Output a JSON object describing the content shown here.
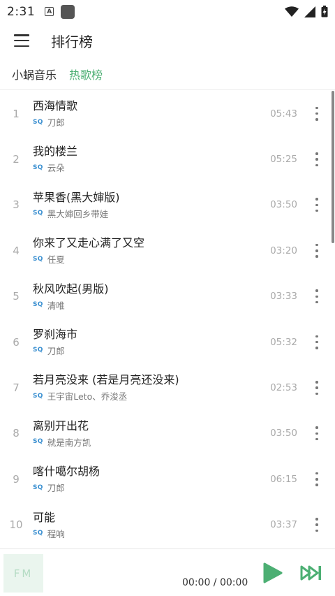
{
  "status": {
    "time": "2:31",
    "notif_letter": "A"
  },
  "appbar": {
    "title": "排行榜"
  },
  "tabs": [
    {
      "label": "小蜗音乐"
    },
    {
      "label": "热歌榜"
    }
  ],
  "songs": [
    {
      "num": "1",
      "title": "西海情歌",
      "quality": "SQ",
      "artist": "刀郎",
      "duration": "05:43"
    },
    {
      "num": "2",
      "title": "我的楼兰",
      "quality": "SQ",
      "artist": "云朵",
      "duration": "05:25"
    },
    {
      "num": "3",
      "title": "苹果香(黑大婶版)",
      "quality": "SQ",
      "artist": "黑大婶回乡带娃",
      "duration": "03:50"
    },
    {
      "num": "4",
      "title": "你来了又走心满了又空",
      "quality": "SQ",
      "artist": "任夏",
      "duration": "03:20"
    },
    {
      "num": "5",
      "title": "秋风吹起(男版)",
      "quality": "SQ",
      "artist": "清唯",
      "duration": "03:33"
    },
    {
      "num": "6",
      "title": "罗刹海市",
      "quality": "SQ",
      "artist": "刀郎",
      "duration": "05:32"
    },
    {
      "num": "7",
      "title": "若月亮没来 (若是月亮还没来)",
      "quality": "SQ",
      "artist": "王宇宙Leto、乔浚丞",
      "duration": "02:53"
    },
    {
      "num": "8",
      "title": "离别开出花",
      "quality": "SQ",
      "artist": "就是南方凯",
      "duration": "03:50"
    },
    {
      "num": "9",
      "title": "喀什噶尔胡杨",
      "quality": "SQ",
      "artist": "刀郎",
      "duration": "06:15"
    },
    {
      "num": "10",
      "title": "可能",
      "quality": "SQ",
      "artist": "程响",
      "duration": "03:37"
    }
  ],
  "player": {
    "cover_text": "FM",
    "time": "00:00 / 00:00",
    "accent": "#4caf73"
  },
  "icons": [
    "menu-icon",
    "play-icon",
    "skip-next-icon",
    "more-vert-icon",
    "wifi-icon",
    "signal-icon",
    "battery-charging-icon"
  ]
}
